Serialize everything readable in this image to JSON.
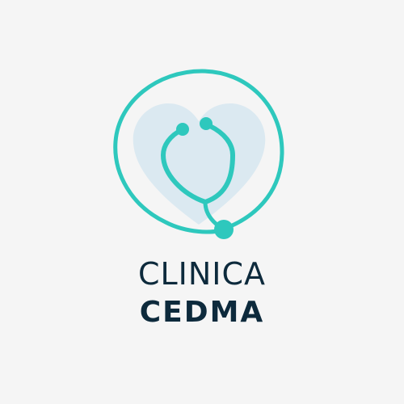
{
  "logo": {
    "name_line_1": "CLINICA",
    "name_line_2": "CEDMA",
    "icon": "stethoscope-heart-icon"
  },
  "colors": {
    "background": "#f5f5f5",
    "accent_teal": "#2ec8bd",
    "heart_fill": "#dbe9f1",
    "text_dark": "#0d2a3c"
  }
}
